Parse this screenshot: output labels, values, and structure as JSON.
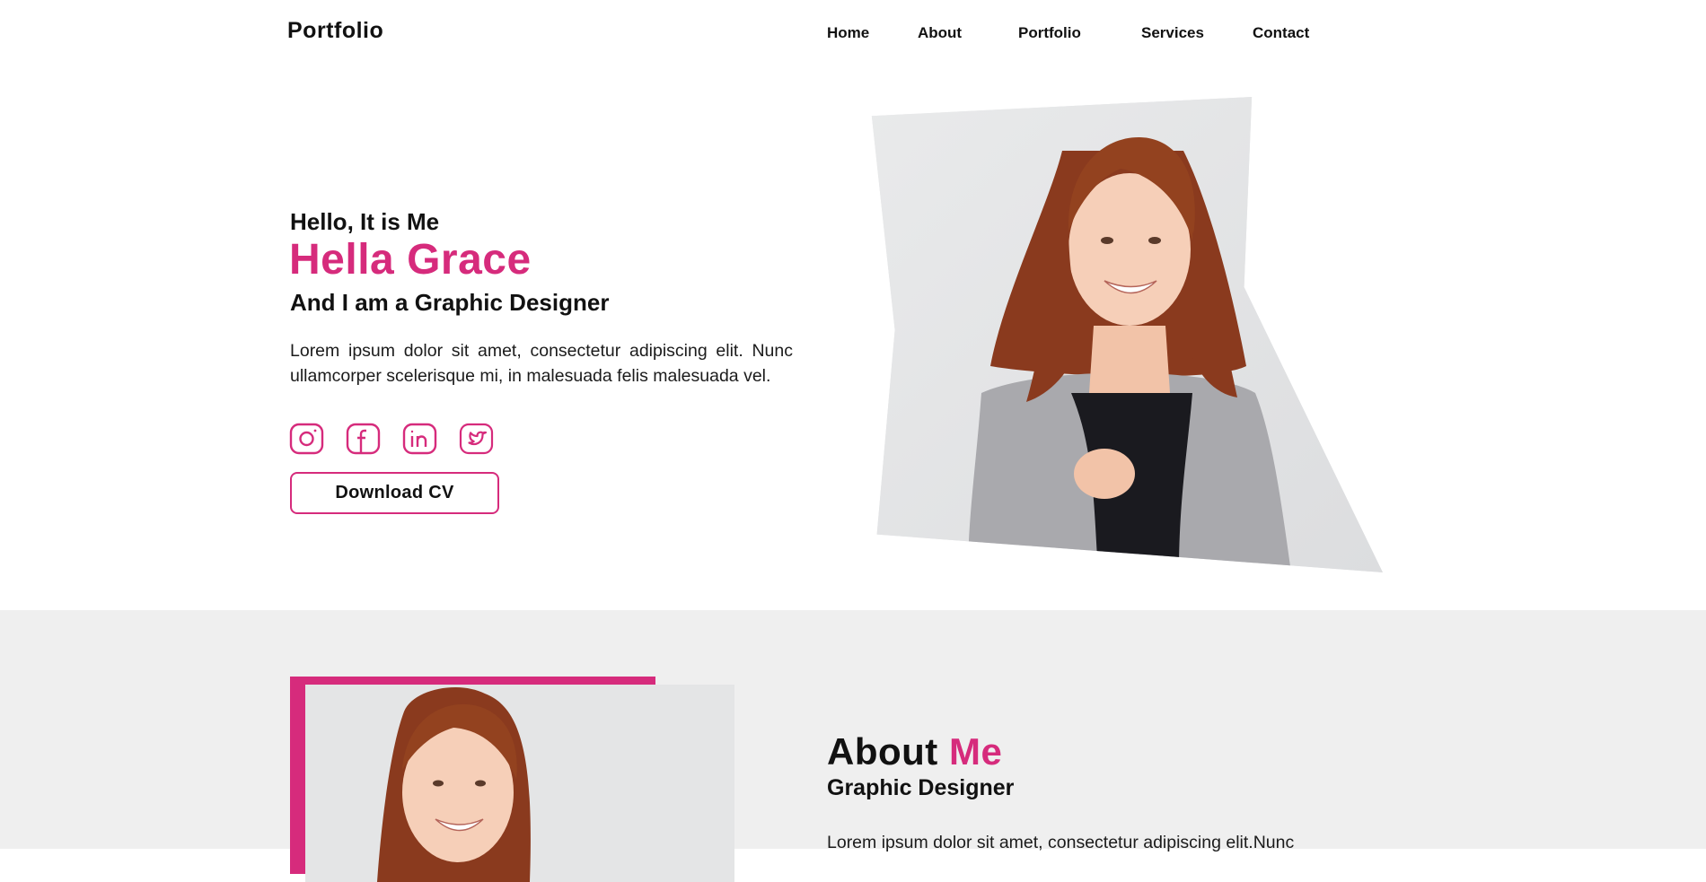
{
  "header": {
    "logo": "Portfolio",
    "nav": [
      {
        "label": "Home"
      },
      {
        "label": "About"
      },
      {
        "label": "Portfolio"
      },
      {
        "label": "Services"
      },
      {
        "label": "Contact"
      }
    ]
  },
  "hero": {
    "greeting": "Hello, It is Me",
    "name": "Hella Grace",
    "role": "And I am a Graphic Designer",
    "description": "Lorem ipsum dolor sit amet, consectetur adipiscing elit. Nunc ullamcorper scelerisque mi, in malesuada felis malesuada vel.",
    "social_icons": [
      "instagram-icon",
      "facebook-icon",
      "linkedin-icon",
      "twitter-icon"
    ],
    "download_label": "Download CV"
  },
  "about": {
    "title_main": "About",
    "title_accent": "Me",
    "subtitle": "Graphic Designer",
    "text": "Lorem ipsum dolor sit amet, consectetur adipiscing elit.Nunc"
  },
  "colors": {
    "accent": "#d62b7c",
    "text": "#111111",
    "about_bg": "#efefef"
  }
}
